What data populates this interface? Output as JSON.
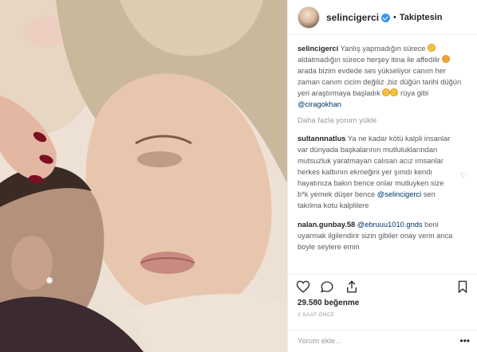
{
  "post": {
    "username": "selincigerci",
    "follow_status": "Takiptesin",
    "separator": "•",
    "caption": {
      "username": "selincigerci",
      "line1": " Yanlış yapmadığın sürece ",
      "line2": " aldatmadığın sürece herşey itina ile affedilir ",
      "line3": " arada bizim evdede ses yükseliyor canım her zaman canım cicim değiliz ,biz düğün tarihi düğün yeri araştırmaya başladık ",
      "line4": " rüya gibi ",
      "mention": "@ciragokhan"
    },
    "load_more": "Daha fazla yorum yükle",
    "comments": [
      {
        "username": "sultannnatlus",
        "text": " Ya ne kadar kötü kalpli insanlar var dünyada başkalarının mutluluklarından mutsuzluk yaratmayan calısan acız ımsanlar herkes kalbının ekmeğini yer şımdı kendı hayatınıza bakın bence onlar mutluyken size b*k yemek düşer bence ",
        "mention": "@selincigerci",
        "text_after": " sen takılma kotu kalplilere"
      },
      {
        "username": "nalan.gunbay.58",
        "mention": "@ebruuu1010.gnds",
        "text_after": " beni uyarmak ilgilendirir sizin gibiler onay verin anca boyle seylere emin"
      }
    ],
    "likes": "29.580 beğenme",
    "time": "2 SAAT ÖNCE",
    "comment_placeholder": "Yorum ekle...",
    "options": "•••"
  },
  "icons": [
    "verified-badge-icon",
    "heart-icon",
    "comment-icon",
    "share-icon",
    "bookmark-icon",
    "comment-like-icon",
    "more-options-icon"
  ],
  "colors": {
    "verified": "#3897f0",
    "mention": "#003569",
    "muted": "#999999",
    "text": "#262626"
  }
}
